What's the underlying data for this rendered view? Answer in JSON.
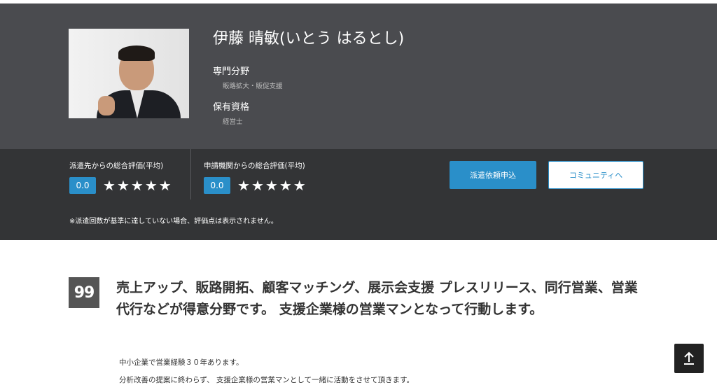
{
  "profile": {
    "name": "伊藤 晴敏(いとう はるとし)",
    "specialty_label": "専門分野",
    "specialty_value": "販路拡大・販促支援",
    "qualification_label": "保有資格",
    "qualification_value": "経営士"
  },
  "ratings": {
    "dispatch_title": "派遣先からの総合評価(平均)",
    "dispatch_score": "0.0",
    "agency_title": "申請機関からの総合評価(平均)",
    "agency_score": "0.0",
    "star_glyph": "★",
    "note": "※派遣回数が基準に達していない場合、評価点は表示されません。"
  },
  "buttons": {
    "request": "派遣依頼申込",
    "community": "コミュニティへ"
  },
  "intro": {
    "headline": "売上アップ、販路開拓、顧客マッチング、展示会支援 プレスリリース、同行営業、営業代行などが得意分野です。 支援企業様の営業マンとなって行動します。",
    "line1": "中小企業で営業経験３０年あります。",
    "line2": "分析改善の提案に終わらず、 支援企業様の営業マンとして一緒に活動をさせて頂きます。"
  },
  "colors": {
    "header_bg": "#4a4b4f",
    "rating_bg": "#333436",
    "accent": "#2a8fc9"
  },
  "icons": {
    "quote": "quote-icon",
    "scroll_top": "arrow-up-icon"
  }
}
